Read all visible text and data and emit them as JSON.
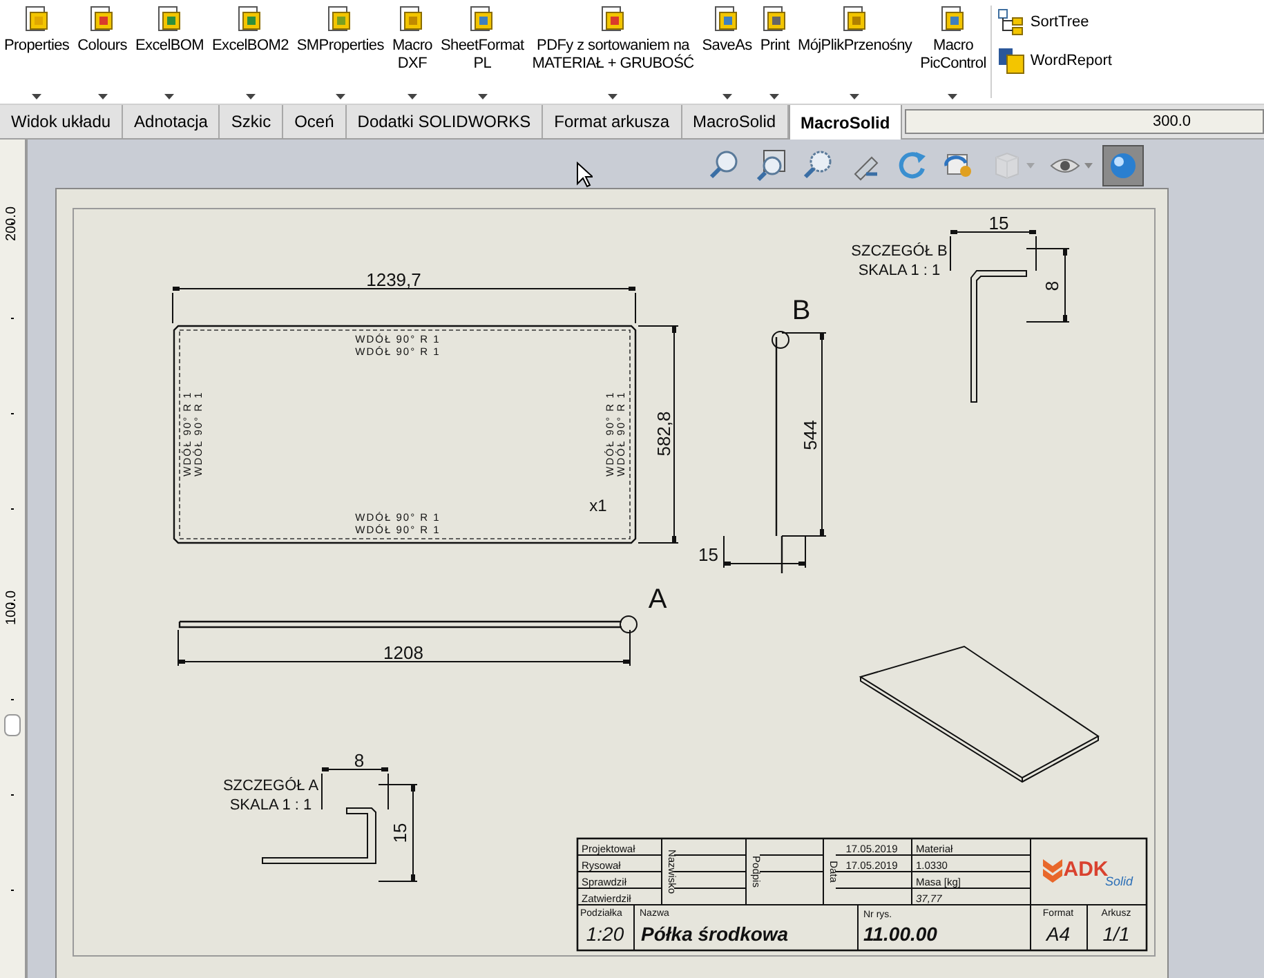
{
  "toolbar": {
    "buttons": [
      {
        "lines": [
          "Properties"
        ]
      },
      {
        "lines": [
          "Colours"
        ]
      },
      {
        "lines": [
          "ExcelBOM"
        ]
      },
      {
        "lines": [
          "ExcelBOM2"
        ]
      },
      {
        "lines": [
          "SMProperties"
        ]
      },
      {
        "lines": [
          "Macro",
          "DXF"
        ]
      },
      {
        "lines": [
          "SheetFormat",
          "PL"
        ]
      },
      {
        "lines": [
          "PDFy z sortowaniem na",
          "MATERIAŁ + GRUBOŚĆ"
        ]
      },
      {
        "lines": [
          "SaveAs"
        ]
      },
      {
        "lines": [
          "Print"
        ]
      },
      {
        "lines": [
          "MójPlikPrzenośny"
        ]
      },
      {
        "lines": [
          "Macro",
          "PicControl"
        ]
      }
    ],
    "side_buttons": [
      {
        "label": "SortTree"
      },
      {
        "label": "WordReport"
      }
    ]
  },
  "tabs": [
    {
      "label": "Widok układu",
      "selected": false
    },
    {
      "label": "Adnotacja",
      "selected": false
    },
    {
      "label": "Szkic",
      "selected": false
    },
    {
      "label": "Oceń",
      "selected": false
    },
    {
      "label": "Dodatki SOLIDWORKS",
      "selected": false
    },
    {
      "label": "Format arkusza",
      "selected": false
    },
    {
      "label": "MacroSolid",
      "selected": false
    },
    {
      "label": "MacroSolid",
      "selected": true
    }
  ],
  "top_ruler": {
    "label": "300.0"
  },
  "left_ruler": {
    "labels": [
      "200.0",
      "100.0"
    ]
  },
  "headsup_toolbar": [
    {
      "kind": "zoom-fit",
      "selected": false,
      "disabled": false,
      "dropdown": false
    },
    {
      "kind": "zoom-area",
      "selected": false,
      "disabled": false,
      "dropdown": false
    },
    {
      "kind": "zoom-select",
      "selected": false,
      "disabled": false,
      "dropdown": false
    },
    {
      "kind": "previous-view",
      "selected": false,
      "disabled": false,
      "dropdown": false
    },
    {
      "kind": "rotate",
      "selected": false,
      "disabled": false,
      "dropdown": false
    },
    {
      "kind": "display-style",
      "selected": false,
      "disabled": false,
      "dropdown": false
    },
    {
      "kind": "cube",
      "selected": false,
      "disabled": true,
      "dropdown": true
    },
    {
      "kind": "eye",
      "selected": false,
      "disabled": false,
      "dropdown": true
    },
    {
      "kind": "sphere",
      "selected": true,
      "disabled": false,
      "dropdown": false
    }
  ],
  "drawing": {
    "flat_pattern": {
      "bend_notes": [
        "WDÓŁ 90° R 1",
        "WDÓŁ 90° R 1",
        "WDÓŁ 90° R 1",
        "WDÓŁ 90° R 1",
        "WDÓŁ 90° R 1",
        "WDÓŁ 90° R 1",
        "WDÓŁ 90° R 1",
        "WDÓŁ 90° R 1"
      ],
      "quantity": "x1",
      "width_dim": "1239,7",
      "height_dim": "582,8"
    },
    "side_view": {
      "length_dim": "1208",
      "detail_letter": "A"
    },
    "front_view": {
      "height_dim": "544",
      "thickness_dim": "15",
      "detail_letter": "B"
    },
    "detail_b": {
      "title": "SZCZEGÓŁ B",
      "scale": "SKALA 1 : 1",
      "width_dim": "15",
      "height_dim": "8"
    },
    "detail_a": {
      "title": "SZCZEGÓŁ A",
      "scale": "SKALA 1 : 1",
      "width_dim": "8",
      "height_dim": "15"
    }
  },
  "title_block": {
    "rows": [
      {
        "label": "Projektował",
        "date": "17.05.2019"
      },
      {
        "label": "Rysował",
        "date": "17.05.2019"
      },
      {
        "label": "Sprawdził"
      },
      {
        "label": "Zatwierdził"
      }
    ],
    "column_headers": [
      "Nazwisko",
      "Podpis",
      "Data"
    ],
    "material_label": "Materiał",
    "material": "1.0330",
    "mass_label": "Masa [kg]",
    "mass": "37,77",
    "scale_label": "Podziałka",
    "scale": "1:20",
    "name_label": "Nazwa",
    "name": "Półka środkowa",
    "drawing_no_label": "Nr rys.",
    "drawing_no": "11.00.00",
    "format_label": "Format",
    "format": "A4",
    "sheet_label": "Arkusz",
    "sheet": "1/1",
    "logo": {
      "text": "ADK",
      "subtext": "Solid"
    }
  }
}
